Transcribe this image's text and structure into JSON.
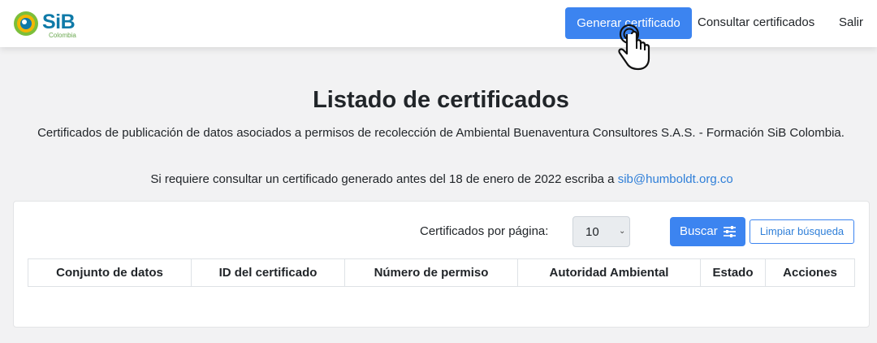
{
  "navbar": {
    "logo_text": "SiB",
    "logo_sub": "Colombia",
    "generate_label": "Generar certificado",
    "consult_label": "Consultar certificados",
    "exit_label": "Salir"
  },
  "page": {
    "title": "Listado de certificados",
    "subtitle": "Certificados de publicación de datos asociados a permisos de recolección de Ambiental Buenaventura Consultores S.A.S. - Formación SiB Colombia.",
    "notice_text": "Si requiere consultar un certificado generado antes del 18 de enero de 2022 escriba a ",
    "notice_email": "sib@humboldt.org.co"
  },
  "controls": {
    "per_page_label": "Certificados por página:",
    "per_page_value": "10",
    "search_label": "Buscar",
    "clear_label": "Limpiar búsqueda"
  },
  "table": {
    "headers": [
      "Conjunto de datos",
      "ID del certificado",
      "Número de permiso",
      "Autoridad Ambiental",
      "Estado",
      "Acciones"
    ]
  },
  "colors": {
    "primary": "#3c84f0",
    "link": "#2f7fd8",
    "logo": "#0f7aa8"
  },
  "icons": {
    "search_button": "sliders-icon",
    "cursor": "hand-pointer-icon"
  }
}
